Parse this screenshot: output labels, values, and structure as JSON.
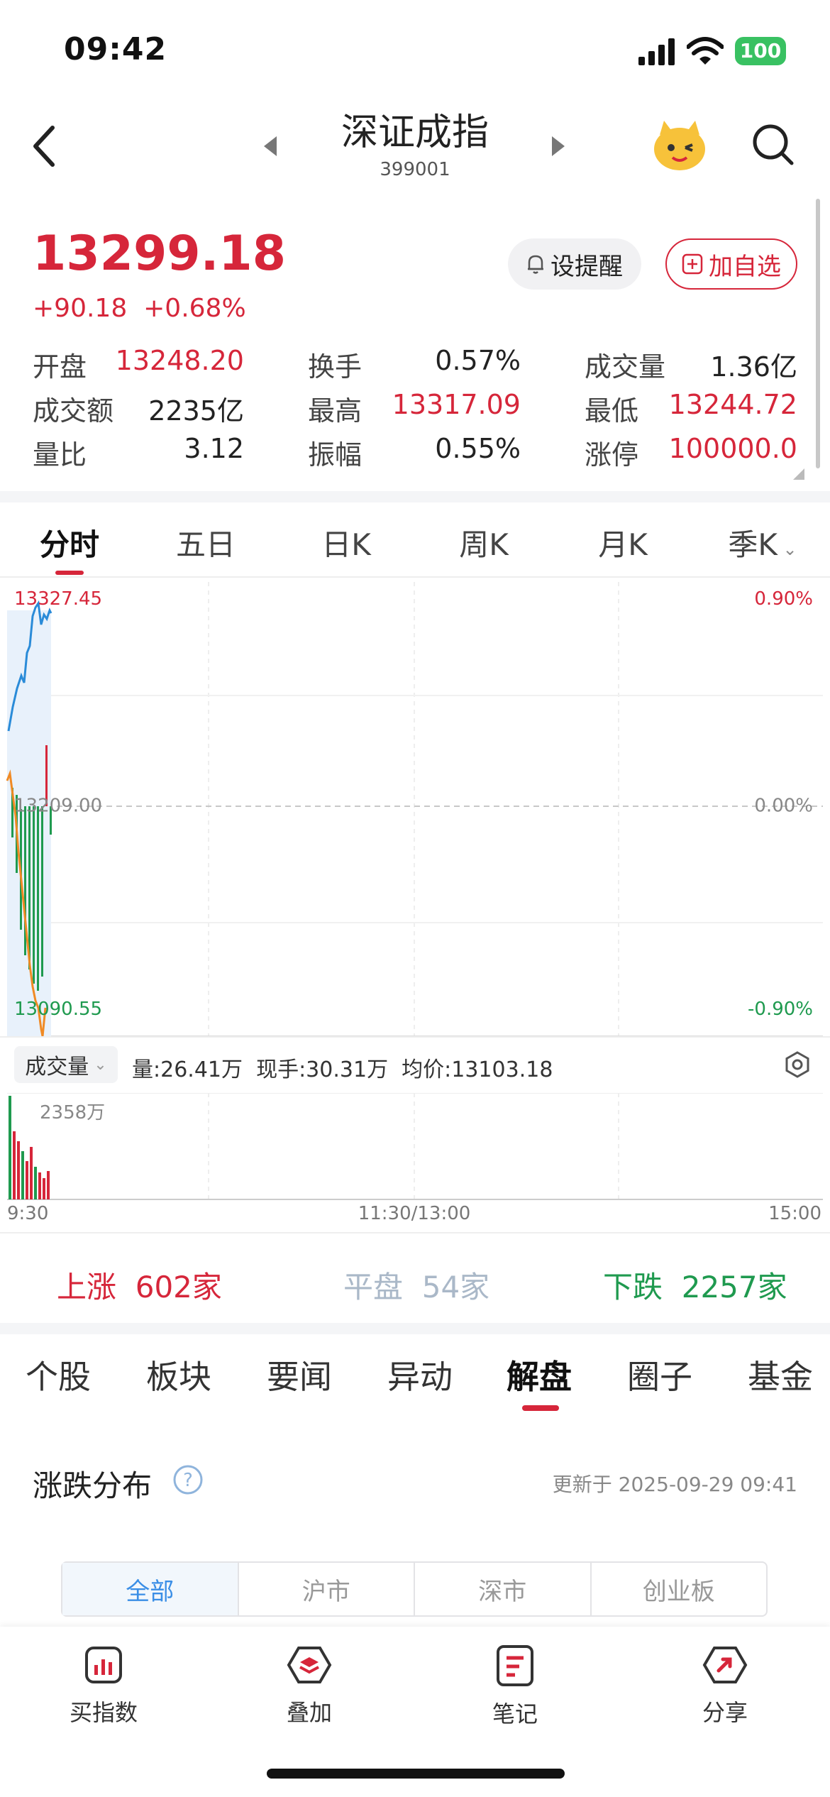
{
  "status": {
    "time": "09:42",
    "battery": "100"
  },
  "header": {
    "title": "深证成指",
    "code": "399001"
  },
  "quote": {
    "price": "13299.18",
    "change": "+90.18",
    "change_pct": "+0.68%",
    "remind_label": "设提醒",
    "add_label": "加自选"
  },
  "stats": [
    {
      "label": "开盘",
      "value": "13248.20",
      "color": "red"
    },
    {
      "label": "换手",
      "value": "0.57%",
      "color": "black"
    },
    {
      "label": "成交量",
      "value": "1.36亿",
      "color": "black"
    },
    {
      "label": "成交额",
      "value": "2235亿",
      "color": "black"
    },
    {
      "label": "最高",
      "value": "13317.09",
      "color": "red"
    },
    {
      "label": "最低",
      "value": "13244.72",
      "color": "red"
    },
    {
      "label": "量比",
      "value": "3.12",
      "color": "black"
    },
    {
      "label": "振幅",
      "value": "0.55%",
      "color": "black"
    },
    {
      "label": "涨停",
      "value": "100000.0",
      "color": "red"
    }
  ],
  "chart_tabs": [
    "分时",
    "五日",
    "日K",
    "周K",
    "月K",
    "季K"
  ],
  "chart": {
    "high_label": "13327.45",
    "mid_label": "13209.00",
    "low_label": "13090.55",
    "high_pct": "0.90%",
    "mid_pct": "0.00%",
    "low_pct": "-0.90%",
    "time_start": "9:30",
    "time_mid": "11:30/13:00",
    "time_end": "15:00"
  },
  "volume_bar": {
    "selector": "成交量",
    "vol": "量:26.41万",
    "current": "现手:30.31万",
    "avg": "均价:13103.18",
    "max_label": "2358万"
  },
  "counts": {
    "up_label": "上涨",
    "up_value": "602家",
    "flat_label": "平盘",
    "flat_value": "54家",
    "down_label": "下跌",
    "down_value": "2257家"
  },
  "news_tabs": [
    "个股",
    "板块",
    "要闻",
    "异动",
    "解盘",
    "圈子",
    "基金"
  ],
  "distribution": {
    "title": "涨跌分布",
    "updated": "更新于 2025-09-29 09:41",
    "segments": [
      "全部",
      "沪市",
      "深市",
      "创业板"
    ]
  },
  "bottom_nav": [
    "买指数",
    "叠加",
    "笔记",
    "分享"
  ],
  "colors": {
    "up": "#d6263a",
    "down": "#1f9a4f",
    "accent": "#3a8ee6"
  }
}
